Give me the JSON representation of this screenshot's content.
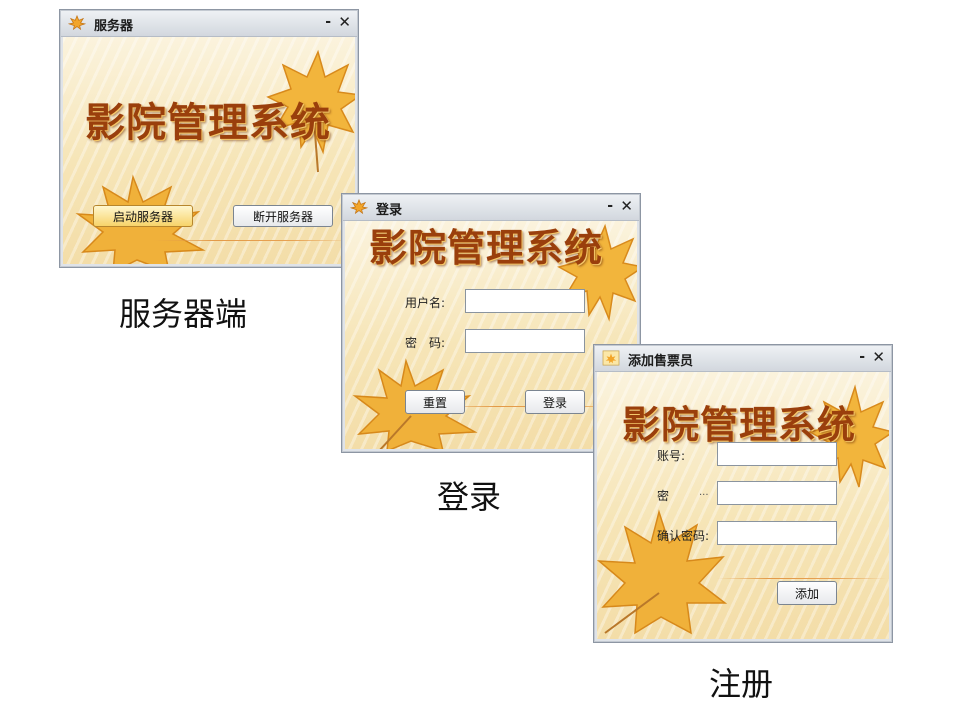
{
  "banner_text": "影院管理系统",
  "server_window": {
    "title": "服务器",
    "minimize": "-",
    "close": "✕",
    "start_button": "启动服务器",
    "stop_button": "断开服务器",
    "caption": "服务器端"
  },
  "login_window": {
    "title": "登录",
    "minimize": "-",
    "close": "✕",
    "username_label": "用户名:",
    "password_label": "密　码:",
    "username_value": "",
    "password_value": "",
    "reset_button": "重置",
    "login_button": "登录",
    "caption": "登录"
  },
  "register_window": {
    "title": "添加售票员",
    "minimize": "-",
    "close": "✕",
    "account_label": "账号:",
    "password_label": "密",
    "password_label_tail": "...",
    "confirm_label": "确认密码:",
    "account_value": "",
    "password_value": "",
    "confirm_value": "",
    "add_button": "添加",
    "caption": "注册"
  },
  "colors": {
    "banner": "#9a3f0c",
    "leaf_fill": "#f2b53c",
    "leaf_dark": "#d88a1c",
    "window_frame": "#8d96a3",
    "background_tint": "#f6e5b7"
  },
  "icons": {
    "app_icon": "maple-leaf-icon",
    "minimize": "minimize-icon",
    "close": "close-icon"
  }
}
